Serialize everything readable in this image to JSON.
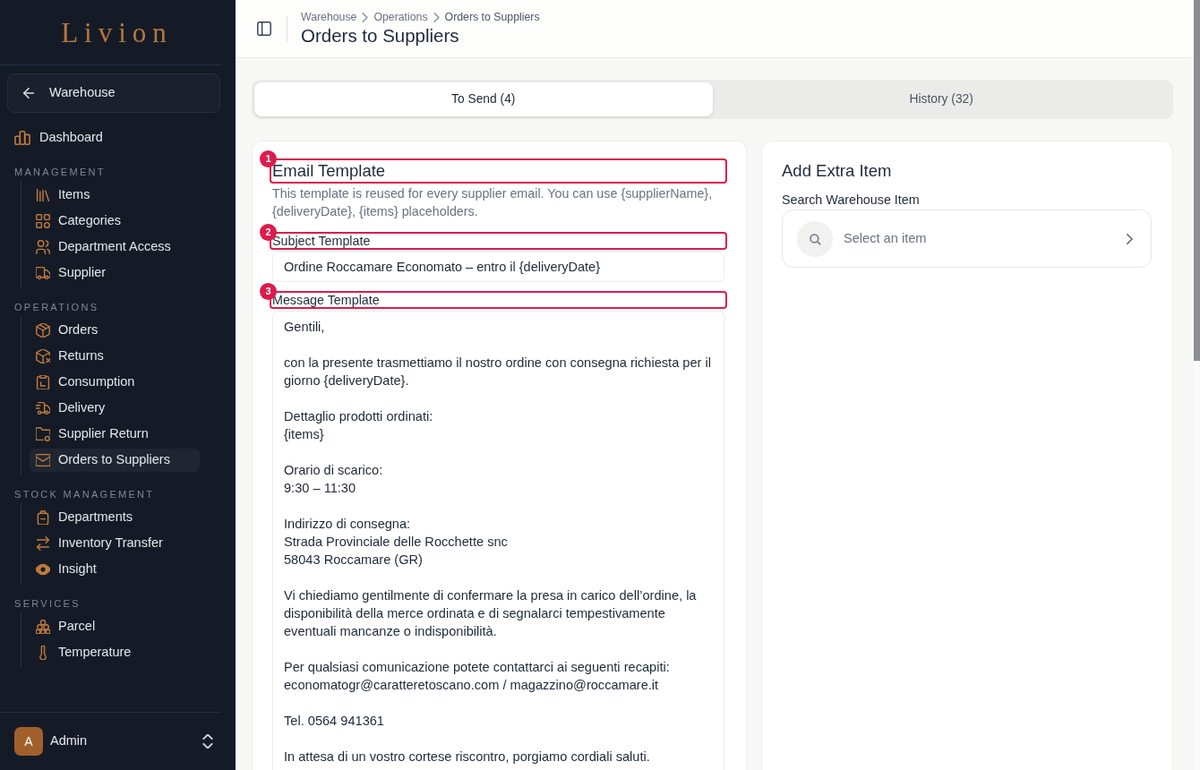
{
  "sidebar": {
    "logo": "Livion",
    "back_button": "Warehouse",
    "items": [
      {
        "label": "Dashboard",
        "selected": false
      }
    ],
    "sections": [
      {
        "title": "MANAGEMENT",
        "items": [
          {
            "label": "Items",
            "selected": false
          },
          {
            "label": "Categories",
            "selected": false
          },
          {
            "label": "Department Access",
            "selected": false
          },
          {
            "label": "Supplier",
            "selected": false
          }
        ]
      },
      {
        "title": "OPERATIONS",
        "items": [
          {
            "label": "Orders",
            "selected": false
          },
          {
            "label": "Returns",
            "selected": false
          },
          {
            "label": "Consumption",
            "selected": false
          },
          {
            "label": "Delivery",
            "selected": false
          },
          {
            "label": "Supplier Return",
            "selected": false
          },
          {
            "label": "Orders to Suppliers",
            "selected": true
          }
        ]
      },
      {
        "title": "STOCK MANAGEMENT",
        "items": [
          {
            "label": "Departments",
            "selected": false
          },
          {
            "label": "Inventory Transfer",
            "selected": false
          },
          {
            "label": "Insight",
            "selected": false
          }
        ]
      },
      {
        "title": "SERVICES",
        "items": [
          {
            "label": "Parcel",
            "selected": false
          },
          {
            "label": "Temperature",
            "selected": false
          }
        ]
      }
    ],
    "user": {
      "initial": "A",
      "name": "Admin"
    }
  },
  "header": {
    "breadcrumb": [
      {
        "label": "Warehouse"
      },
      {
        "label": "Operations"
      },
      {
        "label": "Orders to Suppliers"
      }
    ],
    "title": "Orders to Suppliers"
  },
  "tabs": [
    {
      "label": "To Send (4)",
      "selected": true
    },
    {
      "label": "History (32)",
      "selected": false
    }
  ],
  "email_template": {
    "title": {
      "text": "Email Template",
      "marker": "1"
    },
    "description": "This template is reused for every supplier email. You can use {supplierName}, {deliveryDate}, {items} placeholders.",
    "subject": {
      "label": "Subject Template",
      "marker": "2",
      "value": "Ordine Roccamare Economato – entro il {deliveryDate}"
    },
    "message": {
      "label": "Message Template",
      "marker": "3",
      "value": "Gentili,\n\ncon la presente trasmettiamo il nostro ordine con consegna richiesta per il giorno {deliveryDate}.\n\nDettaglio prodotti ordinati:\n{items}\n\nOrario di scarico:\n9:30 – 11:30\n\nIndirizzo di consegna:\nStrada Provinciale delle Rocchette snc\n58043 Roccamare (GR)\n\nVi chiediamo gentilmente di confermare la presa in carico dell’ordine, la disponibilità della merce ordinata e di segnalarci tempestivamente eventuali mancanze o indisponibilità.\n\nPer qualsiasi comunicazione potete contattarci ai seguenti recapiti:\neconomatogr@caratteretoscano.com / magazzino@roccamare.it\n\nTel. 0564 941361\n\nIn attesa di un vostro cortese riscontro, porgiamo cordiali saluti."
    }
  },
  "extra_item": {
    "title": "Add Extra Item",
    "search": {
      "label": "Search Warehouse Item",
      "placeholder": "Select an item"
    }
  }
}
